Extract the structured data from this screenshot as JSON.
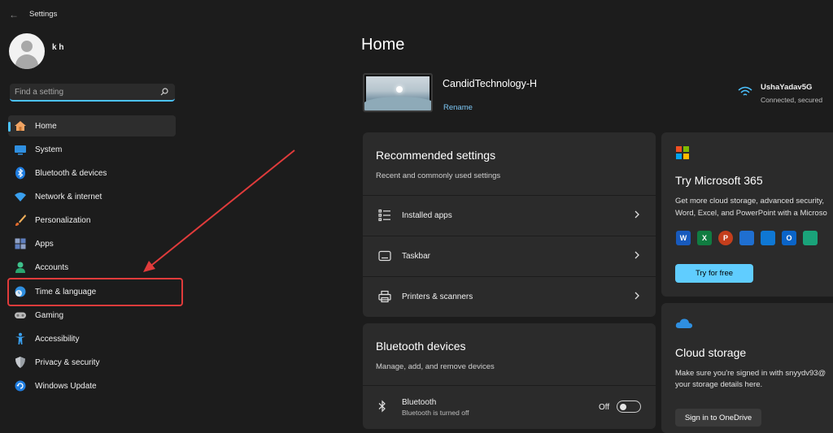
{
  "window": {
    "title": "Settings",
    "back_icon": "back-arrow-icon"
  },
  "profile": {
    "name": "k h"
  },
  "search": {
    "placeholder": "Find a setting",
    "icon": "search-icon"
  },
  "nav": {
    "items": [
      {
        "label": "Home",
        "icon": "home-icon",
        "active": true
      },
      {
        "label": "System",
        "icon": "system-icon"
      },
      {
        "label": "Bluetooth & devices",
        "icon": "bluetooth-icon"
      },
      {
        "label": "Network & internet",
        "icon": "wifi-icon"
      },
      {
        "label": "Personalization",
        "icon": "brush-icon"
      },
      {
        "label": "Apps",
        "icon": "apps-icon"
      },
      {
        "label": "Accounts",
        "icon": "accounts-icon"
      },
      {
        "label": "Time & language",
        "icon": "globe-clock-icon",
        "highlighted": true
      },
      {
        "label": "Gaming",
        "icon": "gamepad-icon"
      },
      {
        "label": "Accessibility",
        "icon": "accessibility-icon"
      },
      {
        "label": "Privacy & security",
        "icon": "shield-icon"
      },
      {
        "label": "Windows Update",
        "icon": "update-icon"
      }
    ]
  },
  "main": {
    "title": "Home",
    "device": {
      "name": "CandidTechnology-H",
      "rename_label": "Rename"
    },
    "wifi": {
      "network": "UshaYadav5G",
      "status": "Connected, secured"
    },
    "recommended": {
      "title": "Recommended settings",
      "subtitle": "Recent and commonly used settings",
      "items": [
        {
          "label": "Installed apps",
          "icon": "list-icon"
        },
        {
          "label": "Taskbar",
          "icon": "taskbar-icon"
        },
        {
          "label": "Printers & scanners",
          "icon": "printer-icon"
        }
      ]
    },
    "bluetooth": {
      "title": "Bluetooth devices",
      "subtitle": "Manage, add, and remove devices",
      "item_label": "Bluetooth",
      "item_status": "Bluetooth is turned off",
      "toggle_label": "Off",
      "enabled": false
    },
    "microsoft365": {
      "title": "Try Microsoft 365",
      "desc_line1": "Get more cloud storage, advanced security,",
      "desc_line2": "Word, Excel, and PowerPoint with a Microso",
      "button_label": "Try for free",
      "apps": [
        {
          "name": "word-icon",
          "letter": "W",
          "color": "#185abd"
        },
        {
          "name": "excel-icon",
          "letter": "X",
          "color": "#107c41"
        },
        {
          "name": "powerpoint-icon",
          "letter": "P",
          "color": "#c43e1c"
        },
        {
          "name": "defender-icon",
          "letter": "",
          "color": "#1f6fd1"
        },
        {
          "name": "onedrive-icon",
          "letter": "",
          "color": "#0f78d4"
        },
        {
          "name": "outlook-icon",
          "letter": "O",
          "color": "#0a64c8"
        },
        {
          "name": "family-icon",
          "letter": "",
          "color": "#1aa37a"
        }
      ]
    },
    "cloud": {
      "title": "Cloud storage",
      "desc_line1": "Make sure you're signed in with snyydv93@",
      "desc_line2": "your storage details here.",
      "button_label": "Sign in to OneDrive"
    }
  },
  "colors": {
    "accent": "#4cc2ff",
    "button": "#60cdff",
    "annotation": "#e03b3b",
    "background": "#1c1c1c",
    "card": "#2b2b2b"
  }
}
